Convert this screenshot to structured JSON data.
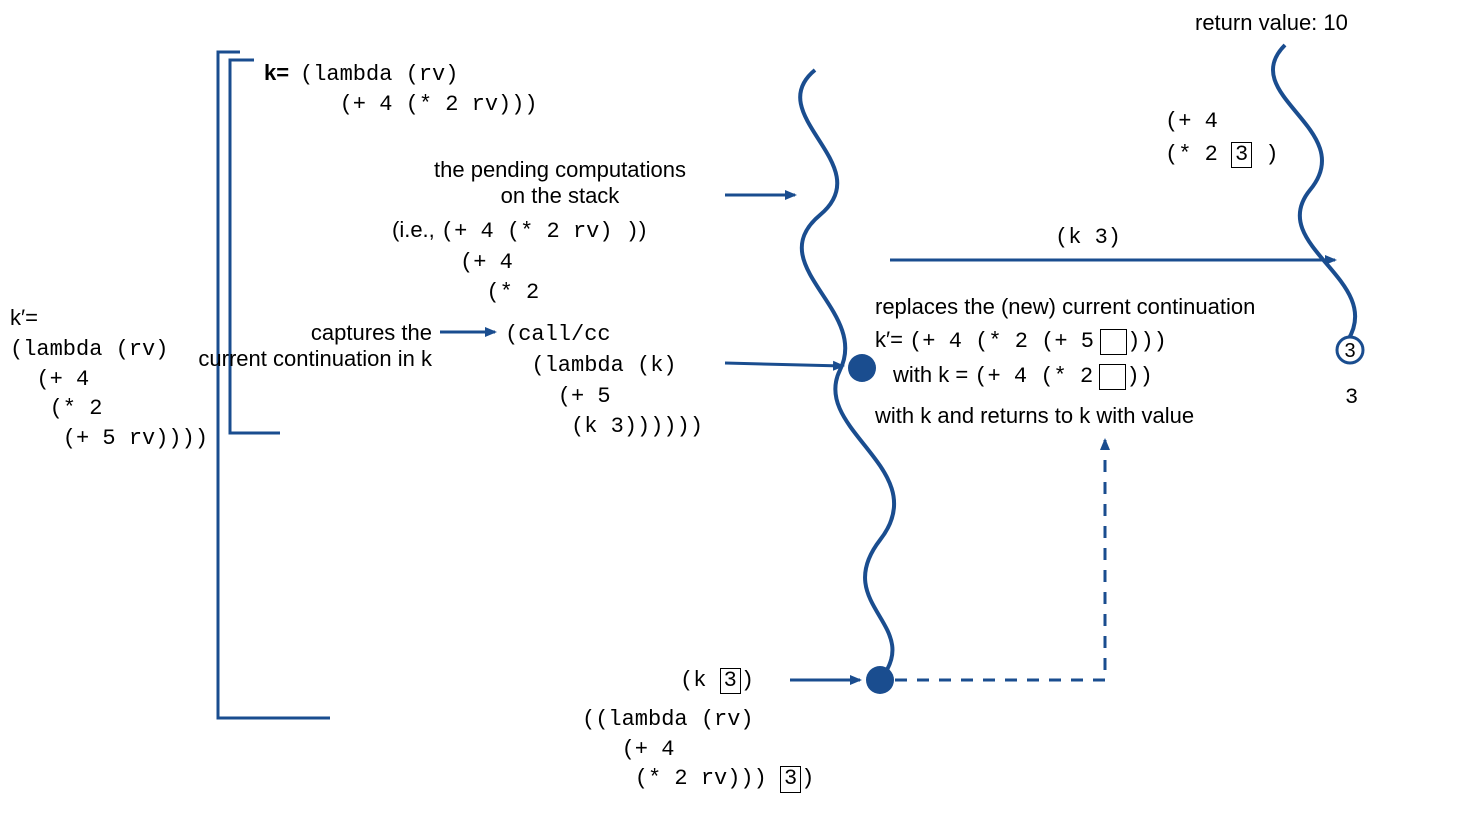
{
  "left": {
    "kprime_eq": "k′=",
    "lambda1": "(lambda (rv)",
    "lambda2": "  (+ 4",
    "lambda3": "   (* 2",
    "lambda4": "    (+ 5 rv))))"
  },
  "topblock": {
    "k_eq": "k=",
    "k_l1": "(lambda (rv)",
    "k_l2": "   (+ 4 (* 2 rv)))"
  },
  "pending": {
    "line1": "the pending computations",
    "line2": "on the stack",
    "ie_prefix": "(i.e.,",
    "ie_code": "(+ 4 (* 2 rv) )",
    "ie_suffix": ")",
    "p4": "(+ 4",
    "star2": "(* 2"
  },
  "captures": {
    "line1": "captures the",
    "line2": "current continuation in k"
  },
  "callcc": {
    "l1": "(call/cc",
    "l2": "  (lambda (k)",
    "l3": "    (+ 5",
    "l4": "     (k 3))))))"
  },
  "k3label": "(k 3)",
  "k3_bottom_pre": "(k",
  "k3_bottom_val": "3",
  "k3_bottom_post": ")",
  "bottom_lambda": {
    "l1": "((lambda (rv)",
    "l2": "   (+ 4",
    "l3": "    (* 2 rv)))",
    "boxed": "3",
    "l3_post": ")"
  },
  "right": {
    "returnval": "return value: 10",
    "p4": "(+ 4",
    "star2_pre": " (* 2",
    "star2_val": "3",
    "star2_post": " )",
    "three": "3"
  },
  "replaces": {
    "l1": "replaces the (new) current continuation",
    "l2_pre": "k′=",
    "l2_code_a": "(+ 4 (* 2 (+ 5",
    "l2_code_b": ")))",
    "l3_pre": "with k =",
    "l3_code_a": "(+ 4  (* 2",
    "l3_code_b": "))",
    "l4": "with k and returns to k with value"
  }
}
